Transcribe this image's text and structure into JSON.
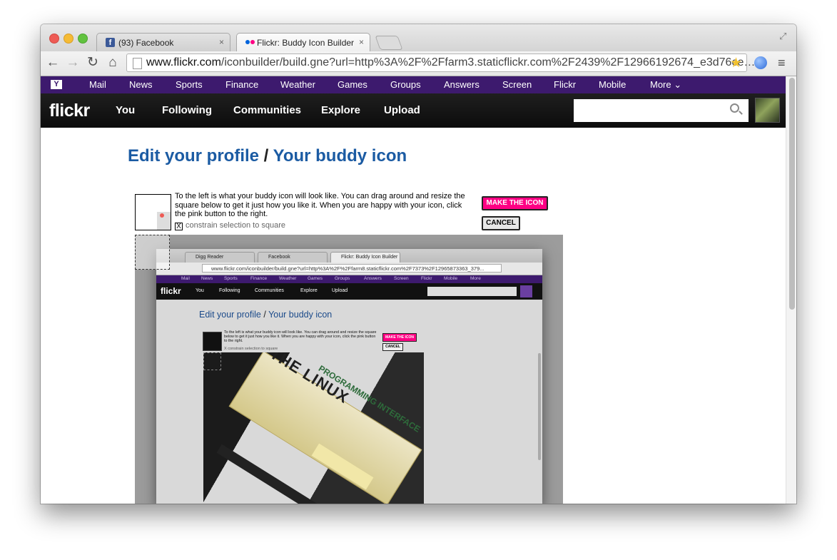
{
  "browser": {
    "tabs": [
      {
        "label": "(93) Facebook",
        "icon": "facebook-icon"
      },
      {
        "label": "Flickr: Buddy Icon Builder",
        "icon": "flickr-icon"
      }
    ],
    "url_host": "www.flickr.com",
    "url_rest": "/iconbuilder/build.gne?url=http%3A%2F%2Ffarm3.staticflickr.com%2F2439%2F12966192674_e3d76ce…",
    "close_glyph": "×",
    "back_glyph": "←",
    "forward_glyph": "→",
    "reload_glyph": "↻",
    "home_glyph": "⌂",
    "star_glyph": "★",
    "menu_glyph": "≡",
    "fullscreen_glyph": "⤢"
  },
  "yahoo_bar": {
    "logo": "Y",
    "links": [
      "Mail",
      "News",
      "Sports",
      "Finance",
      "Weather",
      "Games",
      "Groups",
      "Answers",
      "Screen",
      "Flickr",
      "Mobile",
      "More ⌄"
    ]
  },
  "flickr_nav": {
    "logo": "flickr",
    "links": [
      "You",
      "Following",
      "Communities",
      "Explore",
      "Upload"
    ],
    "search_placeholder": ""
  },
  "page": {
    "heading_link1": "Edit your profile",
    "heading_sep": " / ",
    "heading_link2": "Your buddy icon",
    "instructions": "To the left is what your buddy icon will look like. You can drag around and resize the square below to get it just how you like it. When you are happy with your icon, click the pink button to the right.",
    "constrain_mark": "X",
    "constrain_label": "constrain selection to square",
    "make_button": "MAKE THE ICON",
    "cancel_button": "CANCEL"
  },
  "inner_screenshot": {
    "tabs": [
      "Digg Reader",
      "Facebook",
      "Flickr: Buddy Icon Builder"
    ],
    "url": "www.flickr.com/iconbuilder/build.gne?url=http%3A%2F%2Ffarm8.staticflickr.com%2F7373%2F12965873363_379...",
    "ybar_links": [
      "Mail",
      "News",
      "Sports",
      "Finance",
      "Weather",
      "Games",
      "Groups",
      "Answers",
      "Screen",
      "Flickr",
      "Mobile",
      "More"
    ],
    "logo": "flickr",
    "nav_links": [
      "You",
      "Following",
      "Communities",
      "Explore",
      "Upload"
    ],
    "heading_link1": "Edit your profile",
    "heading_sep": " / ",
    "heading_link2": "Your buddy icon",
    "instructions": "To the left is what your buddy icon will look like. You can drag around and resize the square below to get it just how you like it. When you are happy with your icon, click the pink button to the right.",
    "constrain": "X constrain selection to square",
    "make_button": "MAKE THE ICON",
    "cancel_button": "CANCEL",
    "photo_title": "THE LINUX",
    "photo_subtitle": "PROGRAMMING INTERFACE"
  }
}
